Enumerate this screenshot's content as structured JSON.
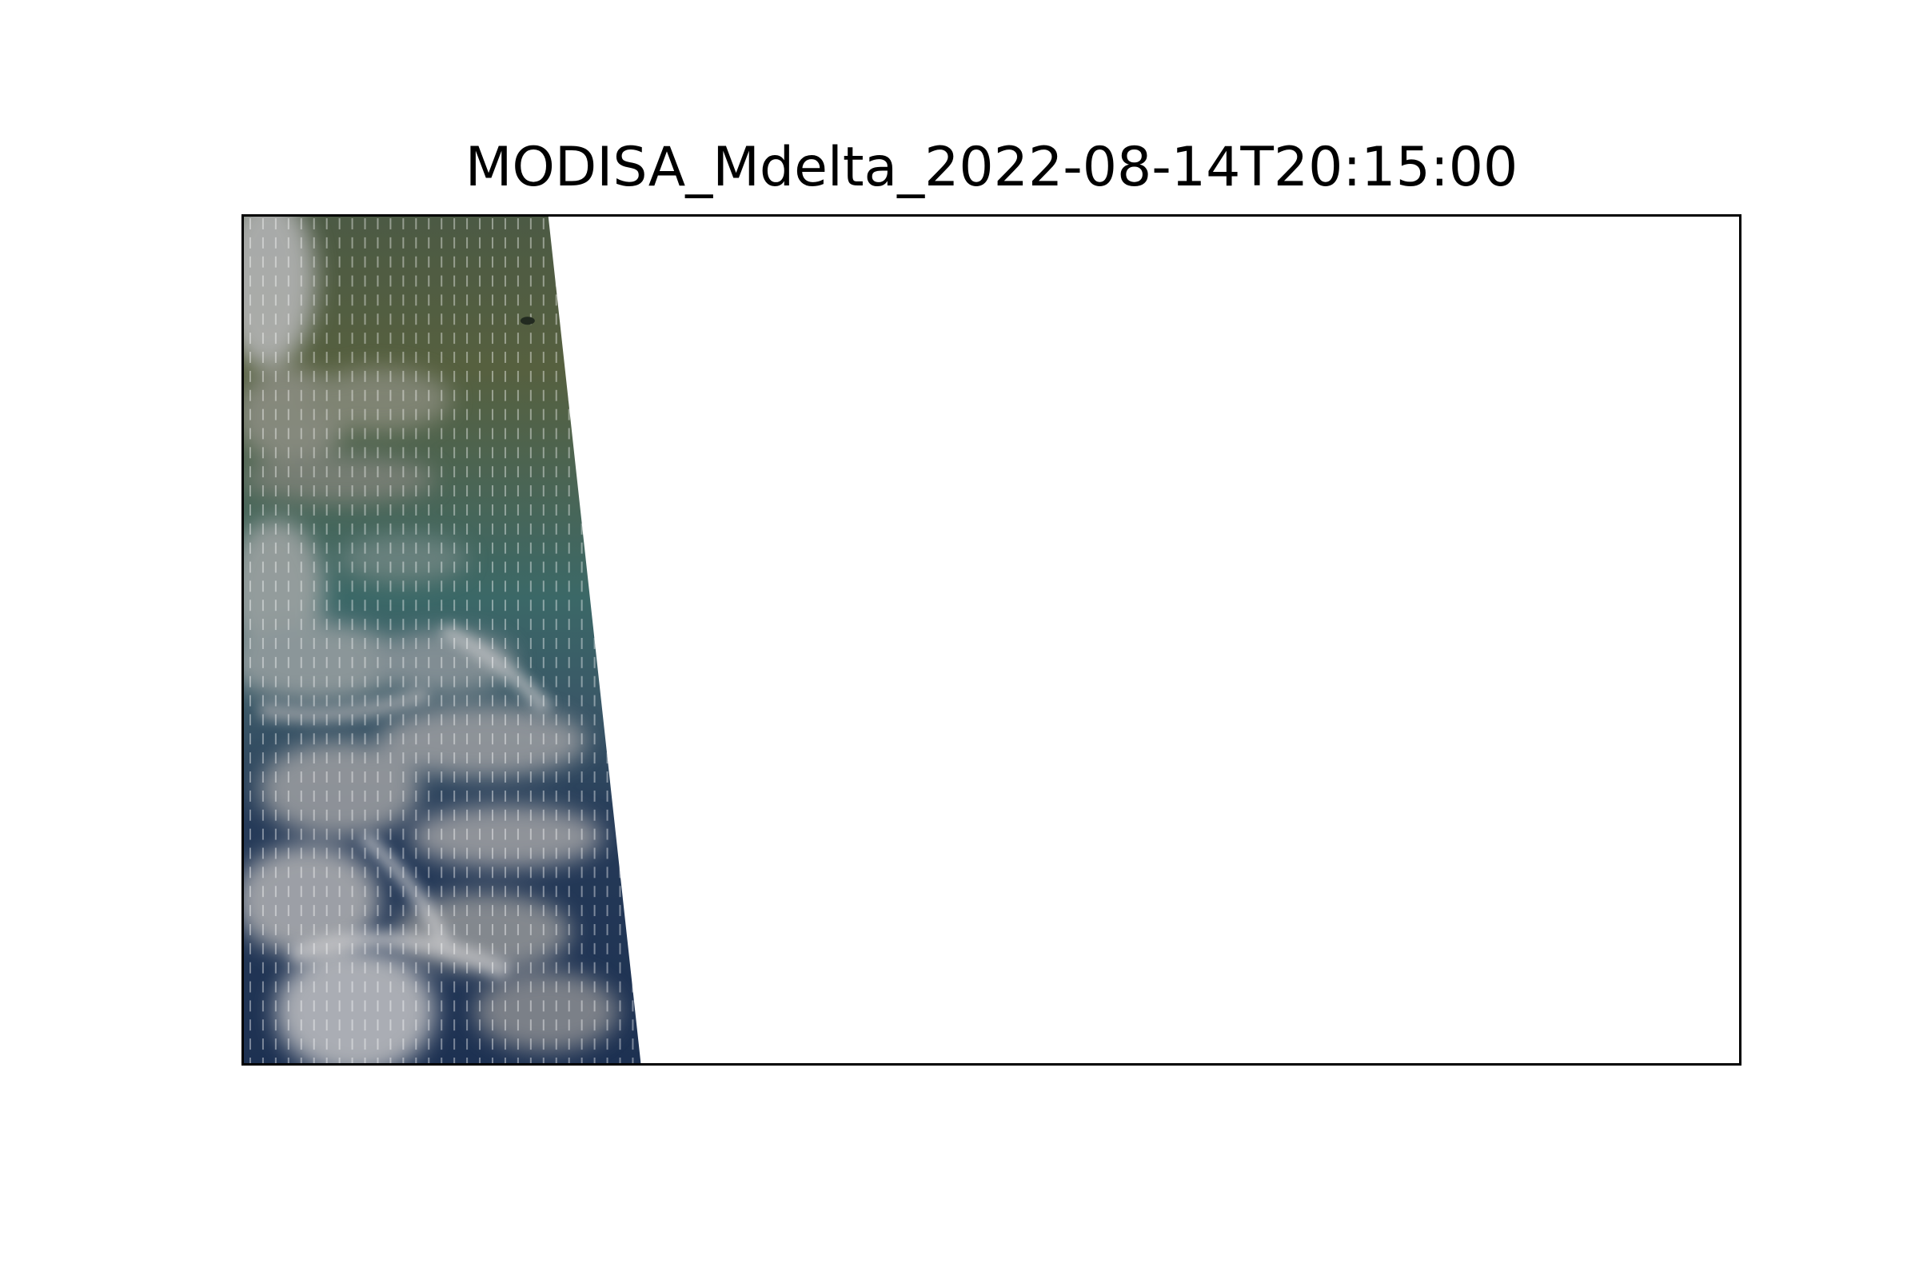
{
  "figure": {
    "title": "MODISA_Mdelta_2022-08-14T20:15:00"
  },
  "image": {
    "description_colors": {
      "land_green": "#4f5d3f",
      "water_teal": "#3f6a66",
      "ocean_blue": "#1f3450",
      "cloud_grey": "#9a9a9c",
      "frame": "#000000",
      "background": "#ffffff"
    }
  }
}
